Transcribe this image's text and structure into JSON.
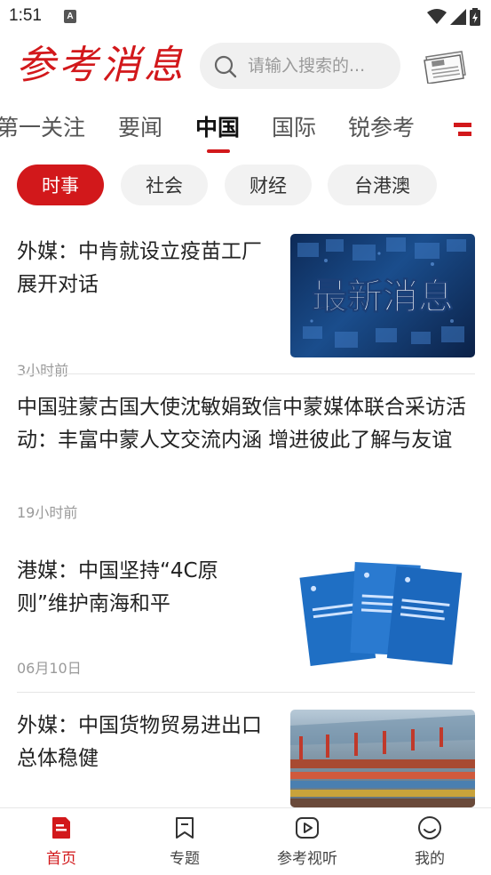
{
  "status_bar": {
    "time": "1:51",
    "notif_icon": "A"
  },
  "header": {
    "logo_text": "参考消息",
    "search_placeholder": "请输入搜索的...",
    "newspaper_icon": "newspaper-icon"
  },
  "tabs": [
    {
      "label": "第一关注"
    },
    {
      "label": "要闻"
    },
    {
      "label": "中国"
    },
    {
      "label": "国际"
    },
    {
      "label": "锐参考"
    }
  ],
  "active_tab": "中国",
  "sub_tabs": [
    {
      "label": "时事"
    },
    {
      "label": "社会"
    },
    {
      "label": "财经"
    },
    {
      "label": "台港澳"
    }
  ],
  "news": [
    {
      "title": "外媒：中肯就设立疫苗工厂展开对话",
      "time": "3小时前",
      "thumb_text": "最新消息"
    },
    {
      "title": "中国驻蒙古国大使沈敏娟致信中蒙媒体联合采访活动：丰富中蒙人文交流内涵  增进彼此了解与友谊",
      "time": "19小时前"
    },
    {
      "title": "港媒：中国坚持“4C原则”维护南海和平",
      "time": "06月10日"
    },
    {
      "title": "外媒：中国货物贸易进出口总体稳健",
      "time": ""
    }
  ],
  "bottom_nav": [
    {
      "label": "首页",
      "icon": "home-doc-icon"
    },
    {
      "label": "专题",
      "icon": "bookmark-icon"
    },
    {
      "label": "参考视听",
      "icon": "play-icon"
    },
    {
      "label": "我的",
      "icon": "smile-icon"
    }
  ],
  "colors": {
    "accent": "#d2181b",
    "chip_bg": "#f2f2f2",
    "muted": "#9a9a9a"
  }
}
